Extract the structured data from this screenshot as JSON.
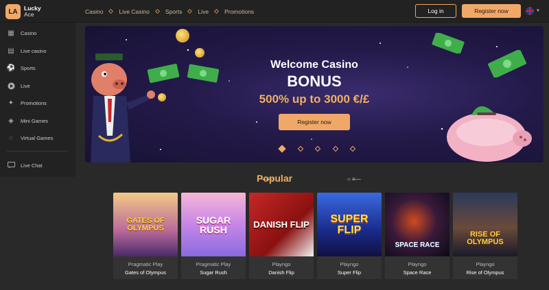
{
  "logo": {
    "badge": "LA",
    "line1": "Lucky",
    "line2": "Ace"
  },
  "nav": {
    "items": [
      "Casino",
      "Live Casino",
      "Sports",
      "Live",
      "Promotions"
    ]
  },
  "header": {
    "login_label": "Log in",
    "register_label": "Register now"
  },
  "sidebar": {
    "items": [
      {
        "label": "Casino",
        "icon": "casino-icon"
      },
      {
        "label": "Live casino",
        "icon": "live-casino-icon"
      },
      {
        "label": "Sports",
        "icon": "sports-icon"
      },
      {
        "label": "Live",
        "icon": "play-icon"
      },
      {
        "label": "Promotions",
        "icon": "promotions-icon"
      },
      {
        "label": "Mini Games",
        "icon": "mini-games-icon"
      },
      {
        "label": "Virtual Games",
        "icon": "virtual-games-icon"
      },
      {
        "label": "Live Chat",
        "icon": "chat-icon"
      }
    ]
  },
  "hero": {
    "title": "Welcome Casino",
    "bonus": "BONUS",
    "offer": "500% up to 3000 €/£",
    "button_label": "Register now"
  },
  "popular": {
    "title": "Popular"
  },
  "games": [
    {
      "provider": "Pragmatic Play",
      "name": "Gates of Olympus",
      "art": "GATES OF OLYMPUS"
    },
    {
      "provider": "Pragmatic Play",
      "name": "Sugar Rush",
      "art": "SUGAR RUSH"
    },
    {
      "provider": "Playngo",
      "name": "Danish Flip",
      "art": "DANISH FLIP"
    },
    {
      "provider": "Playngo",
      "name": "Super Flip",
      "art": "SUPER FLIP"
    },
    {
      "provider": "Playngo",
      "name": "Space Race",
      "art": "SPACE RACE"
    },
    {
      "provider": "Playngo",
      "name": "Rise of Olympus",
      "art": "RISE OF OLYMPUS"
    }
  ],
  "colors": {
    "accent": "#f0a868",
    "background": "#2a2929",
    "highlight": "#f0b060"
  }
}
